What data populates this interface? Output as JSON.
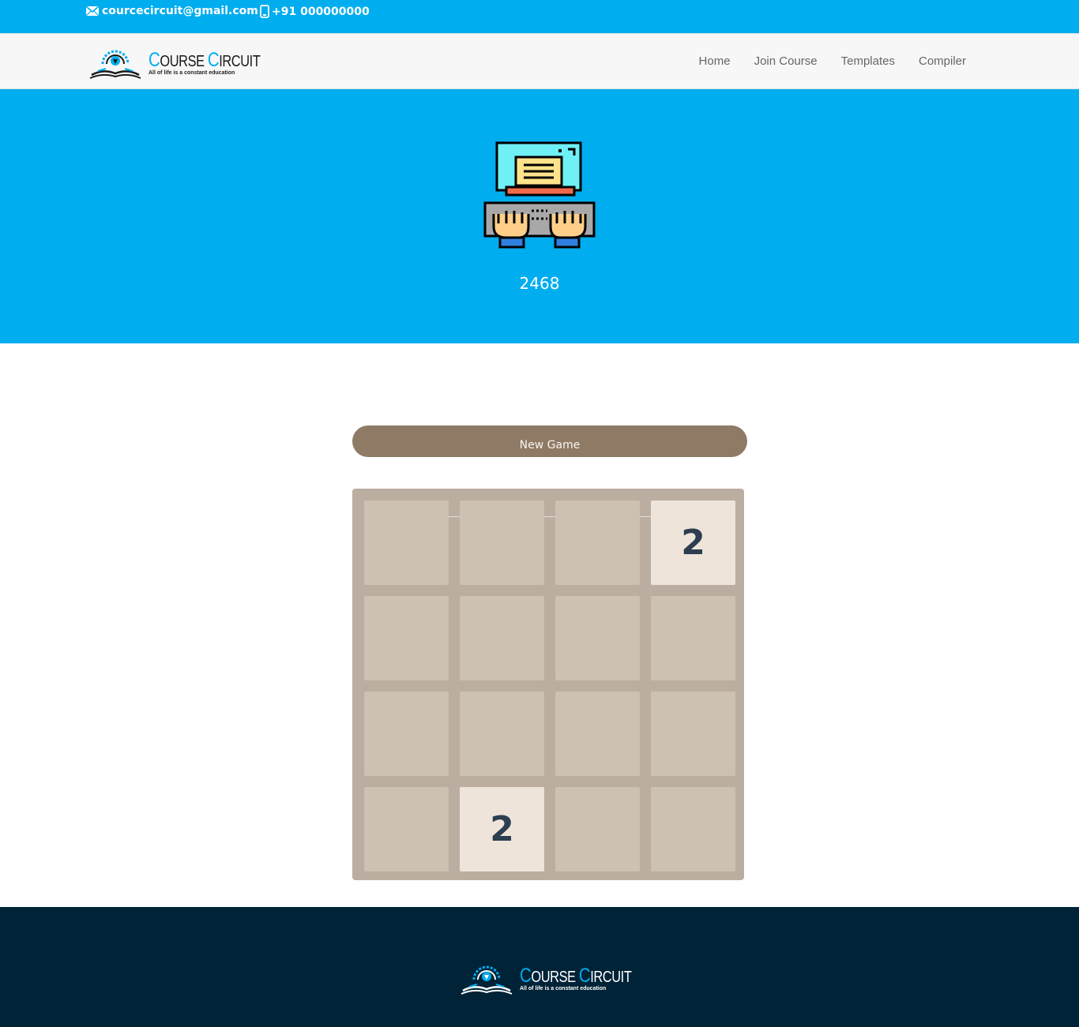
{
  "topbar": {
    "email": "courcecircuit@gmail.com",
    "phone": "+91 000000000"
  },
  "brand": {
    "name_cap1": "C",
    "name_rest1": "OURSE",
    "name_cap2": "C",
    "name_rest2": "IRCUIT",
    "tagline": "All of life is a constant education"
  },
  "nav": {
    "items": [
      "Home",
      "Join Course",
      "Templates",
      "Compiler"
    ]
  },
  "hero": {
    "title": "2468",
    "illustration": "computer-typing-icon"
  },
  "game": {
    "new_game_label": "New Game",
    "grid": [
      [
        "",
        "",
        "",
        "2"
      ],
      [
        "",
        "",
        "",
        ""
      ],
      [
        "",
        "",
        "",
        ""
      ],
      [
        "",
        "2",
        "",
        ""
      ]
    ]
  },
  "colors": {
    "accent": "#00adee",
    "navbar_bg": "#f7f7f7",
    "button_bg": "#8f7a66",
    "board_bg": "#bbada0",
    "empty_cell": "#cdc1b4",
    "tile_2": "#eee4da",
    "tile_text": "#2c3e50",
    "footer_bg": "#002337"
  }
}
